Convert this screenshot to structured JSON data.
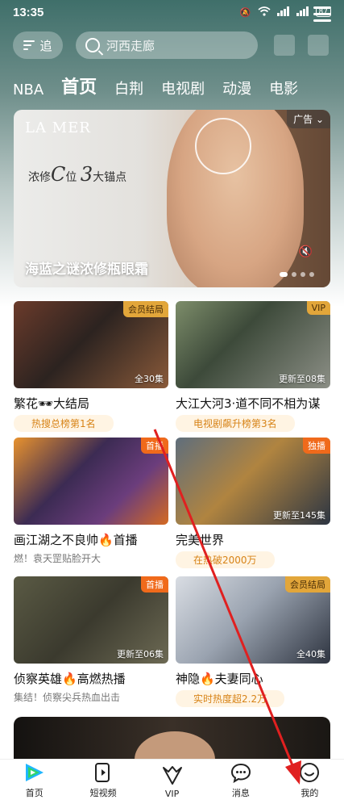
{
  "status": {
    "time": "13:35",
    "battery": "87"
  },
  "header": {
    "follow_label": "追",
    "search_placeholder": "河西走廊"
  },
  "tabs": [
    "NBA",
    "首页",
    "白荆",
    "电视剧",
    "动漫",
    "电影"
  ],
  "active_tab": "首页",
  "banner": {
    "brand": "LA MER",
    "slogan_pre": "浓修",
    "slogan_c": "C",
    "slogan_mid": "位",
    "slogan_3": "3",
    "slogan_post": "大锚点",
    "ad_label": "广告",
    "title": "海蓝之谜浓修瓶眼霜"
  },
  "cards": [
    {
      "title": "繁花🕶大结局",
      "badge": "会员结局",
      "eps": "全30集",
      "sub": "热搜总榜第1名",
      "sub_style": "tag"
    },
    {
      "title": "大江大河3·道不同不相为谋",
      "badge": "VIP",
      "eps": "更新至08集",
      "sub": "电视剧飙升榜第3名",
      "sub_style": "tag"
    },
    {
      "title": "画江湖之不良帅🔥首播",
      "badge": "首播",
      "eps": "",
      "sub": "燃！袁天罡贴脸开大",
      "sub_style": "plain"
    },
    {
      "title": "完美世界",
      "badge": "独播",
      "eps": "更新至145集",
      "sub": "在热破2000万",
      "sub_style": "tag"
    },
    {
      "title": "侦察英雄🔥高燃热播",
      "badge": "首播",
      "eps": "更新至06集",
      "sub": "集结！侦察尖兵热血出击",
      "sub_style": "plain"
    },
    {
      "title": "神隐🔥夫妻同心",
      "badge": "会员结局",
      "eps": "全40集",
      "sub": "实时热度超2.2万",
      "sub_style": "tag"
    }
  ],
  "nav": [
    {
      "label": "首页"
    },
    {
      "label": "短视频"
    },
    {
      "label": "VIP"
    },
    {
      "label": "消息"
    },
    {
      "label": "我的"
    }
  ],
  "colors": {
    "accent_gold": "#e2a63a",
    "accent_orange": "#f06a1b",
    "tag_text": "#d78317",
    "arrow": "#e02020"
  }
}
